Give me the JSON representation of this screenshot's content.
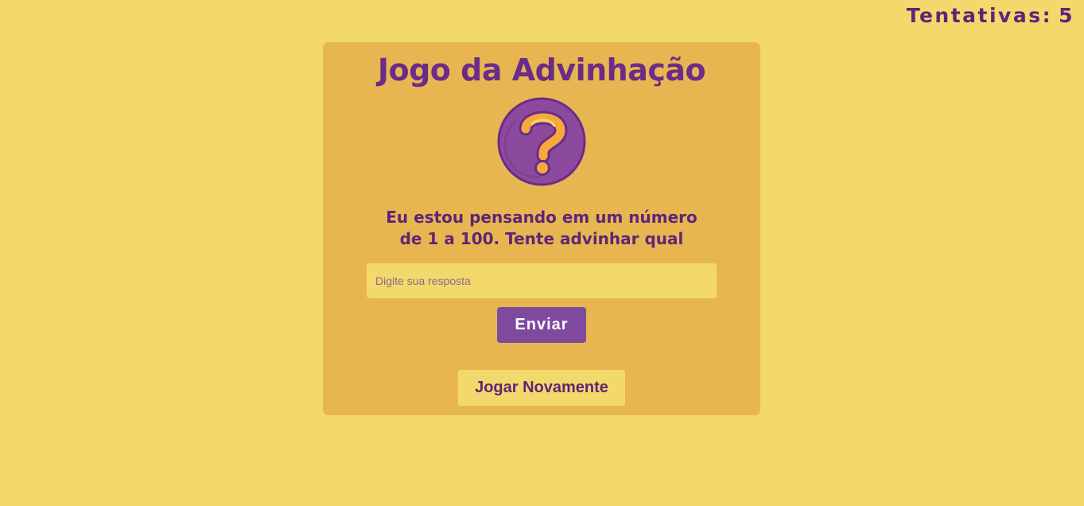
{
  "header": {
    "attempts_label": "Tentativas:",
    "attempts_count": "5"
  },
  "game": {
    "title": "Jogo da Advinhação",
    "prompt_line1": "Eu estou pensando em um número",
    "prompt_line2": "de 1 a 100. Tente advinhar qual",
    "answer_placeholder": "Digite sua resposta",
    "answer_value": "",
    "send_label": "Enviar",
    "replay_label": "Jogar Novamente",
    "icon": "question-mark-icon"
  },
  "colors": {
    "background": "#f3d96b",
    "card": "#e8b651",
    "text_purple": "#5e2577",
    "button_purple": "#7e4a9e",
    "icon_purple": "#8b4a9e",
    "icon_orange": "#f5a93b"
  }
}
